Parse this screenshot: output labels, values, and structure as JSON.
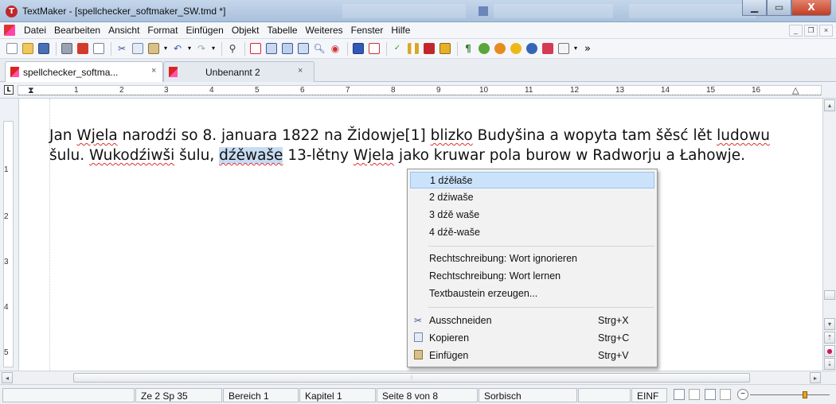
{
  "window": {
    "title": "TextMaker - [spellchecker_softmaker_SW.tmd *]",
    "controls": {
      "minimize": "▁",
      "maximize": "▭",
      "close": "X"
    }
  },
  "menu": {
    "items": [
      "Datei",
      "Bearbeiten",
      "Ansicht",
      "Format",
      "Einfügen",
      "Objekt",
      "Tabelle",
      "Weiteres",
      "Fenster",
      "Hilfe"
    ],
    "mdi": {
      "minimize": "_",
      "restore": "❐",
      "close": "×"
    }
  },
  "toolbar": {
    "overflow": "»"
  },
  "tabs": [
    {
      "label": "spellchecker_softma...",
      "close": "×"
    },
    {
      "label": "Unbenannt 2",
      "close": "×"
    }
  ],
  "ruler": {
    "numbers": [
      "1",
      "2",
      "3",
      "4",
      "5",
      "6",
      "7",
      "8",
      "9",
      "10",
      "11",
      "12",
      "13",
      "14",
      "15",
      "16"
    ]
  },
  "vruler": {
    "numbers": [
      "1",
      "2",
      "3",
      "4",
      "5"
    ]
  },
  "document": {
    "segments": [
      {
        "t": "Jan ",
        "s": ""
      },
      {
        "t": "Wjela",
        "s": "sp"
      },
      {
        "t": " narodźi so 8. januara 1822 na Židowje[1] ",
        "s": ""
      },
      {
        "t": "blizko",
        "s": "sp"
      },
      {
        "t": " Budyšina a wopyta tam šěsć lět ",
        "s": ""
      },
      {
        "t": "ludowu",
        "s": "sp"
      },
      {
        "t": " šulu. ",
        "s": ""
      },
      {
        "t": "Wukodźiwši",
        "s": "sp"
      },
      {
        "t": " šulu, ",
        "s": ""
      },
      {
        "t": "dźěwaše",
        "s": "sel sp"
      },
      {
        "t": " 13-lětny ",
        "s": ""
      },
      {
        "t": "Wjela",
        "s": "sp"
      },
      {
        "t": " jako kruwar pola burow w Radworju a Łahowje.",
        "s": ""
      }
    ]
  },
  "context_menu": {
    "suggestions": [
      "1 dźěłaše",
      "2 dźiwaše",
      "3 dźě waše",
      "4 dźě-waše"
    ],
    "spell_actions": [
      "Rechtschreibung: Wort ignorieren",
      "Rechtschreibung: Wort lernen",
      "Textbaustein erzeugen..."
    ],
    "edit_actions": [
      {
        "label": "Ausschneiden",
        "shortcut": "Strg+X",
        "icon": "scissors-icon"
      },
      {
        "label": "Kopieren",
        "shortcut": "Strg+C",
        "icon": "copy-icon"
      },
      {
        "label": "Einfügen",
        "shortcut": "Strg+V",
        "icon": "paste-icon"
      }
    ]
  },
  "status": {
    "position": "Ze 2 Sp 35",
    "area": "Bereich 1",
    "chapter": "Kapitel 1",
    "page": "Seite 8 von 8",
    "language": "Sorbisch",
    "mode": "EINF"
  },
  "colors": {
    "selection": "#c6dcf2",
    "menu_highlight": "#cbe3fa",
    "spell_error": "#e03030"
  }
}
